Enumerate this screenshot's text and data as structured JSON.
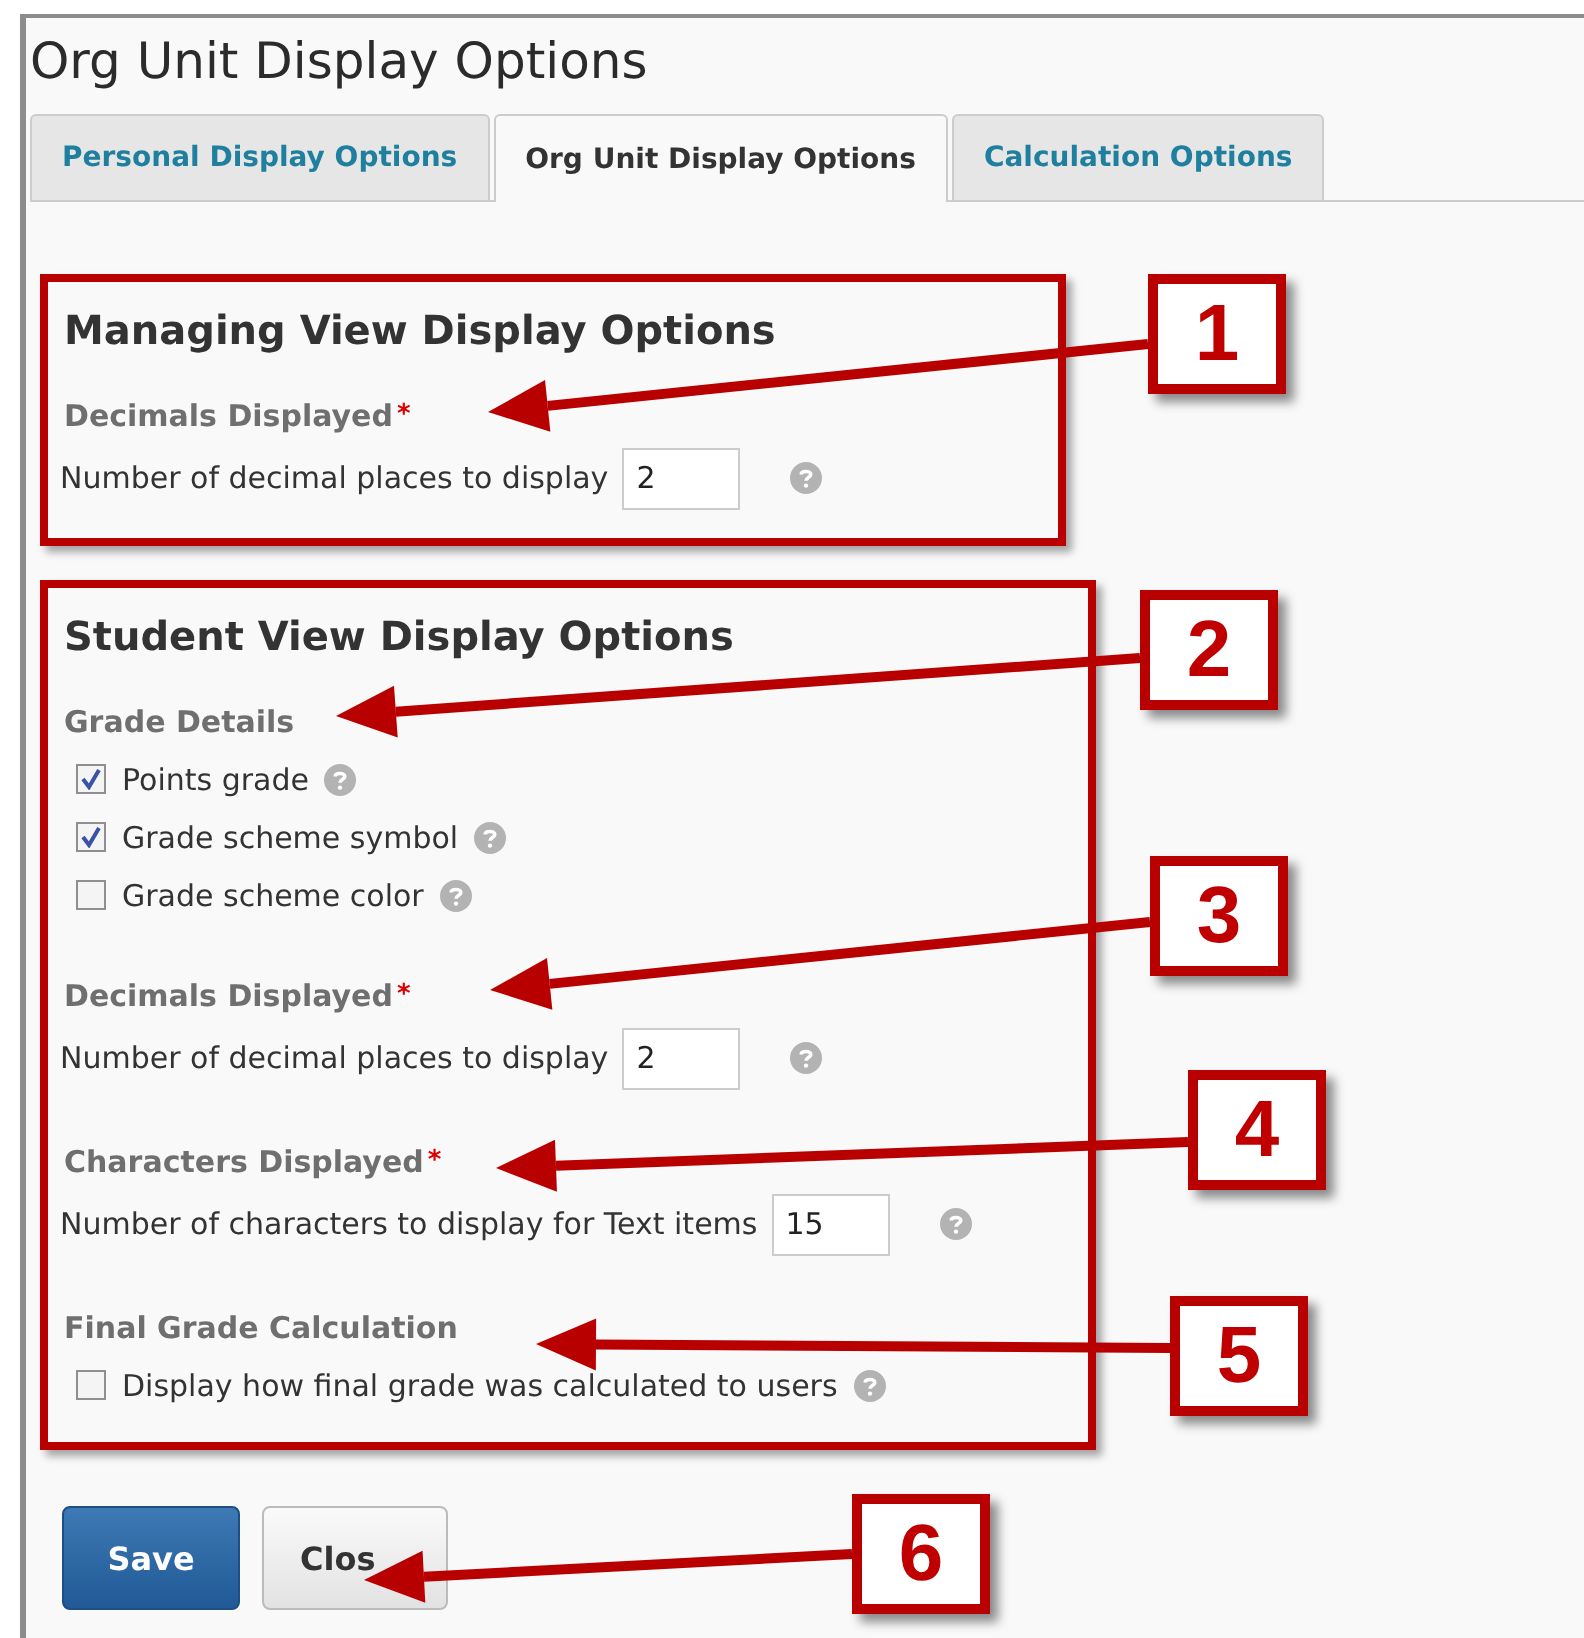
{
  "title": "Org Unit Display Options",
  "tabs": [
    {
      "label": "Personal Display Options",
      "selected": false
    },
    {
      "label": "Org Unit Display Options",
      "selected": true
    },
    {
      "label": "Calculation Options",
      "selected": false
    }
  ],
  "sections": [
    {
      "heading": "Managing View Display Options",
      "groups": [
        {
          "kind": "number",
          "label": "Decimals Displayed",
          "marker": "*",
          "prompt": "Number of decimal places to display",
          "value": "2"
        }
      ]
    },
    {
      "heading": "Student View Display Options",
      "groups": [
        {
          "kind": "checks",
          "label": "Grade Details",
          "items": [
            {
              "label": "Points grade",
              "checked": true
            },
            {
              "label": "Grade scheme symbol",
              "checked": true
            },
            {
              "label": "Grade scheme color",
              "checked": false
            }
          ]
        },
        {
          "kind": "number",
          "label": "Decimals Displayed",
          "marker": "*",
          "prompt": "Number of decimal places to display",
          "value": "2"
        },
        {
          "kind": "number",
          "label": "Characters Displayed",
          "marker": "*",
          "prompt": "Number of characters to display for Text items",
          "value": "15"
        },
        {
          "kind": "checks",
          "label": "Final Grade Calculation",
          "items": [
            {
              "label": "Display how final grade was calculated to users",
              "checked": false
            }
          ]
        }
      ]
    }
  ],
  "buttons": [
    {
      "label": "Save",
      "primary": true
    },
    {
      "label": "Clos",
      "primary": false
    }
  ],
  "callouts": [
    "1",
    "2",
    "3",
    "4",
    "5",
    "6"
  ]
}
